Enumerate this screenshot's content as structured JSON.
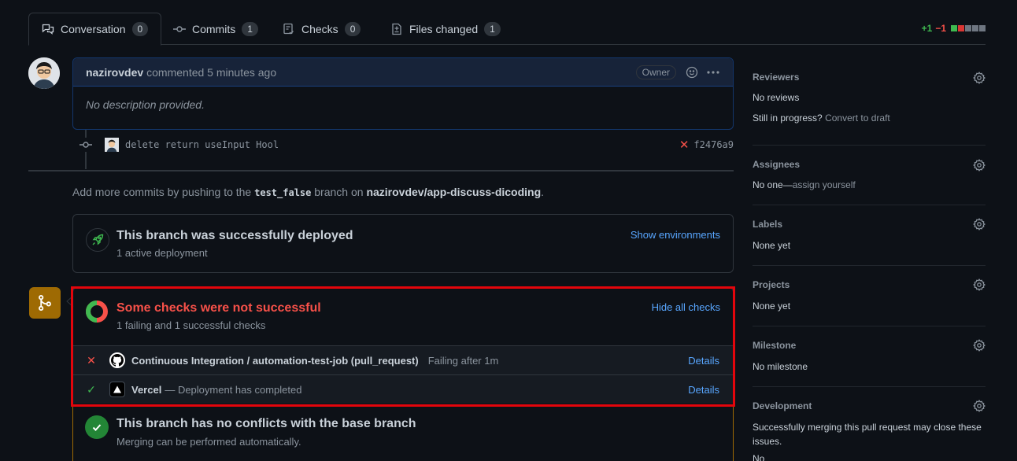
{
  "tabs": [
    {
      "label": "Conversation",
      "count": "0"
    },
    {
      "label": "Commits",
      "count": "1"
    },
    {
      "label": "Checks",
      "count": "0"
    },
    {
      "label": "Files changed",
      "count": "1"
    }
  ],
  "diffstat": {
    "additions": "+1",
    "deletions": "−1",
    "colors": [
      "#3fb950",
      "#da3633",
      "#6e7681",
      "#6e7681",
      "#6e7681"
    ]
  },
  "comment": {
    "author": "nazirovdev",
    "action": "commented 5 minutes ago",
    "badge": "Owner",
    "body": "No description provided."
  },
  "commit": {
    "message": "delete return useInput Hool",
    "sha": "f2476a9"
  },
  "push_hint": {
    "prefix": "Add more commits by pushing to the",
    "branch": "test_false",
    "middle": "branch on",
    "repo": "nazirovdev/app-discuss-dicoding",
    "suffix": "."
  },
  "deploy": {
    "title": "This branch was successfully deployed",
    "subtitle": "1 active deployment",
    "link": "Show environments"
  },
  "checks": {
    "title": "Some checks were not successful",
    "subtitle": "1 failing and 1 successful checks",
    "link": "Hide all checks",
    "rows": [
      {
        "name": "Continuous Integration / automation-test-job (pull_request)",
        "desc": "Failing after 1m",
        "details": "Details"
      },
      {
        "name": "Vercel",
        "desc": "— Deployment has completed",
        "details": "Details"
      }
    ]
  },
  "conflicts": {
    "title": "This branch has no conflicts with the base branch",
    "subtitle": "Merging can be performed automatically."
  },
  "sidebar": {
    "reviewers": {
      "title": "Reviewers",
      "line1": "No reviews",
      "line2_prefix": "Still in progress?",
      "line2_link": "Convert to draft"
    },
    "assignees": {
      "title": "Assignees",
      "prefix": "No one—",
      "link": "assign yourself"
    },
    "labels": {
      "title": "Labels",
      "value": "None yet"
    },
    "projects": {
      "title": "Projects",
      "value": "None yet"
    },
    "milestone": {
      "title": "Milestone",
      "value": "No milestone"
    },
    "development": {
      "title": "Development",
      "value": "Successfully merging this pull request may close these issues.",
      "extra": "No"
    }
  }
}
